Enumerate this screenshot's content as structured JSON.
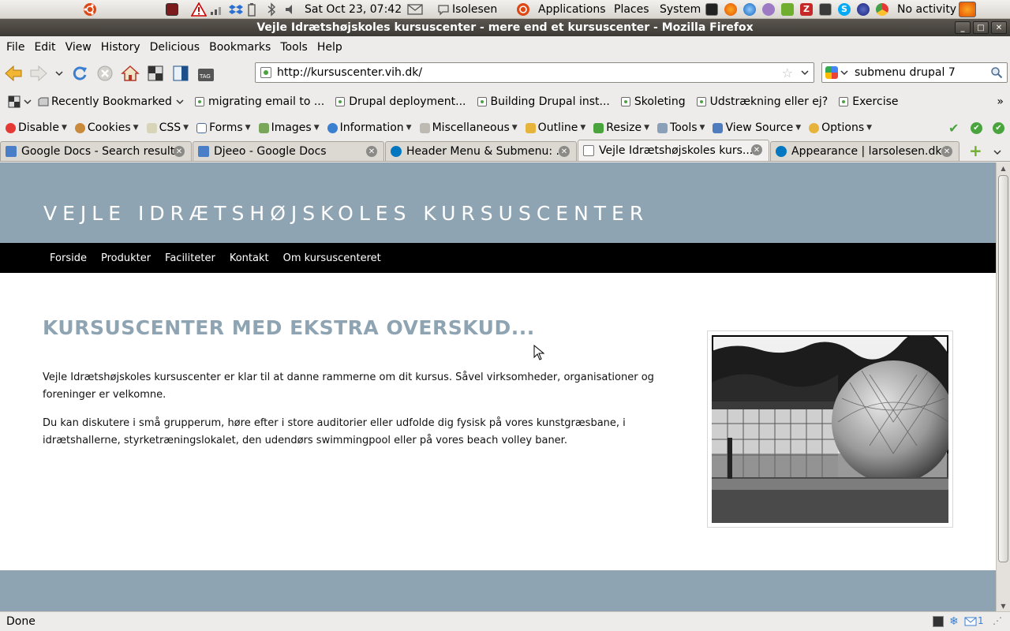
{
  "panel": {
    "datetime": "Sat Oct 23, 07:42",
    "user": "Isolesen",
    "menus": [
      "Applications",
      "Places",
      "System"
    ],
    "status": "No activity"
  },
  "window": {
    "title": "Vejle Idrætshøjskoles kursuscenter - mere end et kursuscenter - Mozilla Firefox"
  },
  "menubar": [
    "File",
    "Edit",
    "View",
    "History",
    "Delicious",
    "Bookmarks",
    "Tools",
    "Help"
  ],
  "navbar": {
    "url": "http://kursuscenter.vih.dk/",
    "search_query": "submenu drupal 7"
  },
  "bookmarks": {
    "recent": "Recently Bookmarked",
    "items": [
      "migrating email to ...",
      "Drupal deployment...",
      "Building Drupal inst...",
      "Skoleting",
      "Udstrækning eller ej?",
      "Exercise"
    ],
    "overflow": "»"
  },
  "devbar": {
    "items": [
      "Disable",
      "Cookies",
      "CSS",
      "Forms",
      "Images",
      "Information",
      "Miscellaneous",
      "Outline",
      "Resize",
      "Tools",
      "View Source",
      "Options"
    ]
  },
  "tabs": [
    {
      "label": "Google Docs - Search results",
      "active": false
    },
    {
      "label": "Djeeo - Google Docs",
      "active": false
    },
    {
      "label": "Header Menu & Submenu: ...",
      "active": false
    },
    {
      "label": "Vejle Idrætshøjskoles kurs...",
      "active": true
    },
    {
      "label": "Appearance | larsolesen.dk",
      "active": false
    }
  ],
  "page": {
    "site_title": "VEJLE IDRÆTSHØJSKOLES KURSUSCENTER",
    "nav": [
      "Forside",
      "Produkter",
      "Faciliteter",
      "Kontakt",
      "Om kursuscenteret"
    ],
    "heading": "KURSUSCENTER MED EKSTRA OVERSKUD...",
    "paragraphs": [
      "Vejle Idrætshøjskoles kursuscenter er klar til at danne rammerne om dit kursus. Såvel virksomheder, organisationer og foreninger er velkomne.",
      "Du kan diskutere i små grupperum, høre efter i store auditorier eller udfolde dig fysisk på vores kunstgræsbane, i idrætshallerne, styrketræningslokalet, den udendørs swimmingpool eller på vores beach volley baner."
    ]
  },
  "statusbar": {
    "text": "Done",
    "mail_count": "1"
  },
  "colors": {
    "site_blue": "#8fa4b2",
    "nav_black": "#000000"
  }
}
